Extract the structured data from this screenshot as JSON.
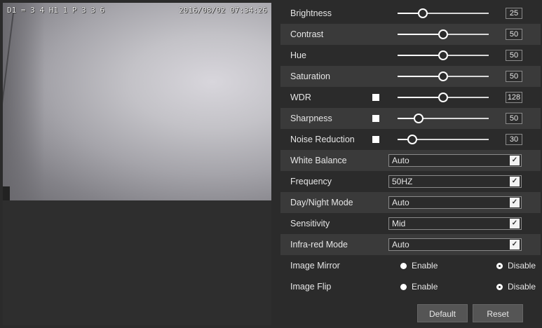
{
  "preview": {
    "osd_left": "D1 = 3 4 H1 1 P 3 3 6",
    "osd_datetime": "2016/08/02 07:34:26"
  },
  "sliders": [
    {
      "label": "Brightness",
      "value": "25",
      "percent": 28,
      "checkbox": false
    },
    {
      "label": "Contrast",
      "value": "50",
      "percent": 50,
      "checkbox": false
    },
    {
      "label": "Hue",
      "value": "50",
      "percent": 50,
      "checkbox": false
    },
    {
      "label": "Saturation",
      "value": "50",
      "percent": 50,
      "checkbox": false
    },
    {
      "label": "WDR",
      "value": "128",
      "percent": 50,
      "checkbox": true
    },
    {
      "label": "Sharpness",
      "value": "50",
      "percent": 23,
      "checkbox": true
    },
    {
      "label": "Noise Reduction",
      "value": "30",
      "percent": 16,
      "checkbox": true
    }
  ],
  "selects": [
    {
      "label": "White Balance",
      "value": "Auto"
    },
    {
      "label": "Frequency",
      "value": "50HZ"
    },
    {
      "label": "Day/Night Mode",
      "value": "Auto"
    },
    {
      "label": "Sensitivity",
      "value": "Mid"
    },
    {
      "label": "Infra-red Mode",
      "value": "Auto"
    }
  ],
  "radios": [
    {
      "label": "Image Mirror",
      "option1": "Enable",
      "option2": "Disable",
      "selected": "Enable"
    },
    {
      "label": "Image Flip",
      "option1": "Enable",
      "option2": "Disable",
      "selected": "Enable"
    }
  ],
  "buttons": {
    "default_label": "Default",
    "reset_label": "Reset"
  },
  "colors": {
    "background": "#2b2b2b",
    "row_alt": "#3a3a3a",
    "text": "#e6e6e6"
  }
}
